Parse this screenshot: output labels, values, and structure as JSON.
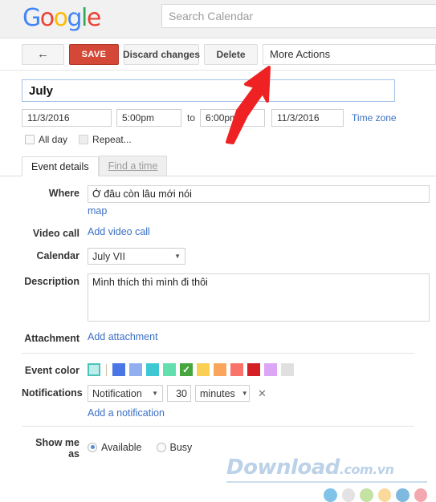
{
  "header": {
    "logo_text": "Google",
    "logo_letters": [
      {
        "ch": "G",
        "color": "#4285F4"
      },
      {
        "ch": "o",
        "color": "#EA4335"
      },
      {
        "ch": "o",
        "color": "#FBBC05"
      },
      {
        "ch": "g",
        "color": "#4285F4"
      },
      {
        "ch": "l",
        "color": "#34A853"
      },
      {
        "ch": "e",
        "color": "#EA4335"
      }
    ],
    "search": {
      "placeholder": "Search Calendar",
      "value": ""
    }
  },
  "toolbar": {
    "back_label": "←",
    "save_label": "SAVE",
    "discard_label": "Discard changes",
    "delete_label": "Delete",
    "more_actions_label": "More Actions"
  },
  "event": {
    "title": "July",
    "start_date": "11/3/2016",
    "start_time": "5:00pm",
    "to_label": "to",
    "end_time": "6:00pm",
    "end_date": "11/3/2016",
    "timezone_link": "Time zone",
    "all_day_label": "All day",
    "repeat_label": "Repeat...",
    "tabs": [
      {
        "label": "Event details",
        "active": true
      },
      {
        "label": "Find a time",
        "active": false
      }
    ],
    "where": {
      "label": "Where",
      "value": "Ở đâu còn lâu mới nói",
      "map_link": "map"
    },
    "video_call": {
      "label": "Video call",
      "link": "Add video call"
    },
    "calendar": {
      "label": "Calendar",
      "selected": "July VII"
    },
    "description": {
      "label": "Description",
      "value": "Mình thích thì mình đi thôi"
    },
    "attachment": {
      "label": "Attachment",
      "link": "Add attachment"
    },
    "event_color": {
      "label": "Event color",
      "current": "#a9e4e0",
      "swatches": [
        {
          "color": "#4a77e5",
          "selected": false
        },
        {
          "color": "#91afef",
          "selected": false
        },
        {
          "color": "#3fc8d4",
          "selected": false
        },
        {
          "color": "#63dfae",
          "selected": false
        },
        {
          "color": "#46a63e",
          "selected": true
        },
        {
          "color": "#f9d053",
          "selected": false
        },
        {
          "color": "#f9a65c",
          "selected": false
        },
        {
          "color": "#f9736a",
          "selected": false
        },
        {
          "color": "#d41f26",
          "selected": false
        },
        {
          "color": "#dda5f5",
          "selected": false
        },
        {
          "color": "#e0e0e0",
          "selected": false
        }
      ]
    },
    "notifications": {
      "label": "Notifications",
      "type": "Notification",
      "amount": "30",
      "unit": "minutes",
      "remove_label": "✕",
      "add_link": "Add a notification"
    },
    "show_me_as": {
      "label": "Show me as",
      "options": [
        {
          "label": "Available",
          "selected": true
        },
        {
          "label": "Busy",
          "selected": false
        }
      ]
    }
  },
  "watermark": {
    "main": "Download",
    "suffix": ".com.vn",
    "dots": [
      "#7fc4e8",
      "#e3e3e3",
      "#c5e2a5",
      "#fbd99a",
      "#7fb9e0",
      "#f3a7b0"
    ]
  },
  "annotation": {
    "arrow_color": "#ee2222",
    "points_at": "delete-button"
  }
}
